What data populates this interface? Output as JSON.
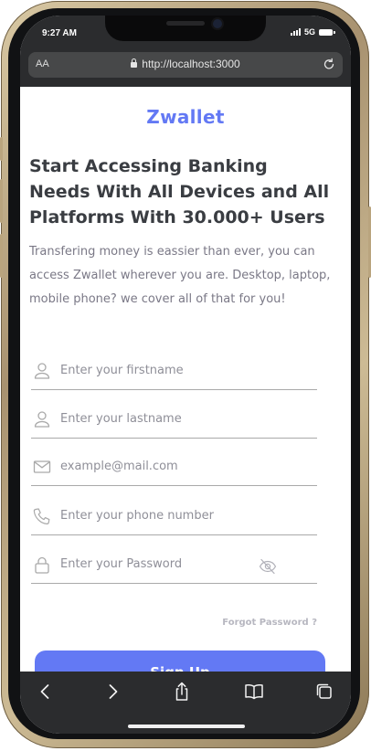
{
  "status": {
    "time": "9:27 AM",
    "network": "5G"
  },
  "browser": {
    "aa_label": "AA",
    "url": "http://localhost:3000"
  },
  "brand": "Zwallet",
  "headline": "Start Accessing Banking Needs With All Devices and All Platforms With 30.000+ Users",
  "description": "Transfering money is eassier than ever, you can access Zwallet wherever you are. Desktop, laptop, mobile phone? we cover all of that for you!",
  "form": {
    "firstname_placeholder": "Enter your firstname",
    "lastname_placeholder": "Enter your lastname",
    "email_placeholder": "example@mail.com",
    "phone_placeholder": "Enter your phone number",
    "password_placeholder": "Enter your Password",
    "forgot_label": "Forgot Password ?",
    "signup_label": "Sign Up"
  },
  "icons": {
    "firstname": "user-icon",
    "lastname": "user-icon",
    "email": "mail-icon",
    "phone": "phone-icon",
    "password": "lock-icon",
    "toggle_password": "eye-off-icon",
    "toolbar": [
      "back-icon",
      "forward-icon",
      "share-icon",
      "bookmarks-icon",
      "tabs-icon"
    ]
  },
  "colors": {
    "primary": "#6379F4",
    "heading": "#3a3d42",
    "text_muted": "#7a7886",
    "browser_chrome": "#2b2c2e"
  }
}
